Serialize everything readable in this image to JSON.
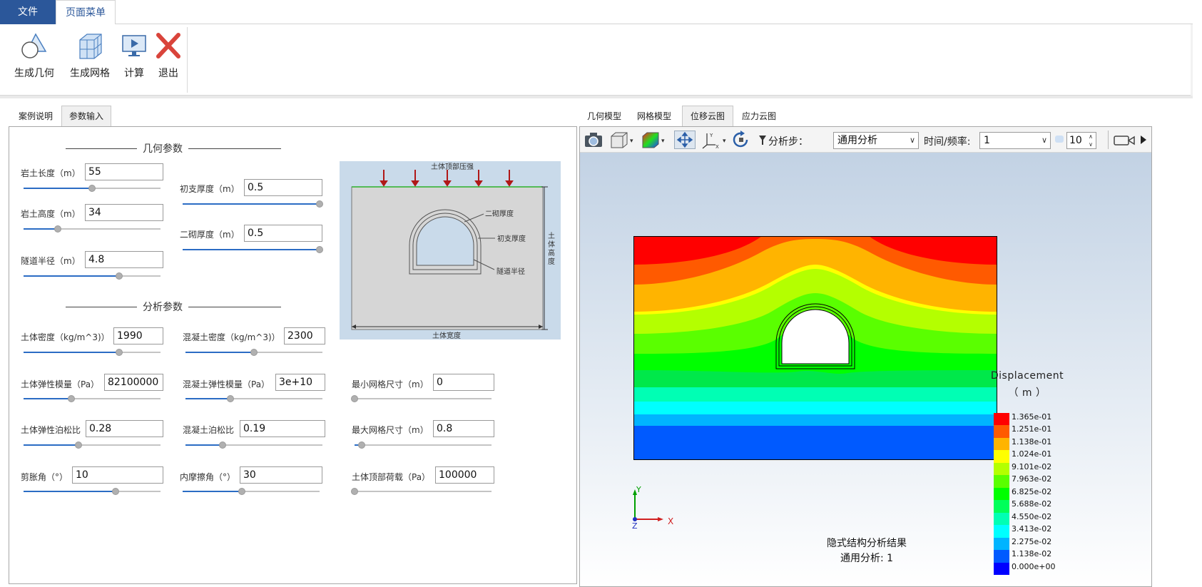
{
  "menu": {
    "file": "文件",
    "page": "页面菜单"
  },
  "ribbon": {
    "gen_geometry": "生成几何",
    "gen_mesh": "生成网格",
    "compute": "计算",
    "exit": "退出"
  },
  "left_tabs": [
    "案例说明",
    "参数输入"
  ],
  "right_tabs": [
    "几何模型",
    "网格模型",
    "位移云图",
    "应力云图"
  ],
  "geometry": {
    "title": "几何参数",
    "params": [
      {
        "label": "岩土长度（m）",
        "value": "55",
        "slider": 0.5
      },
      {
        "label": "岩土高度（m）",
        "value": "34",
        "slider": 0.25
      },
      {
        "label": "隧道半径（m）",
        "value": "4.8",
        "slider": 0.7
      },
      {
        "label": "初支厚度（m）",
        "value": "0.5",
        "slider": 1.0
      },
      {
        "label": "二砌厚度（m）",
        "value": "0.5",
        "slider": 1.0
      }
    ]
  },
  "analysis": {
    "title": "分析参数",
    "params": [
      {
        "label": "土体密度（kg/m^3)）",
        "value": "1990",
        "slider": 0.7
      },
      {
        "label": "混凝土密度（kg/m^3)）",
        "value": "2300",
        "slider": 0.5
      },
      {
        "label": "土体弹性模量（Pa）",
        "value": "82100000",
        "slider": 0.35
      },
      {
        "label": "混凝土弹性模量（Pa）",
        "value": "3e+10",
        "slider": 0.33
      },
      {
        "label": "最小网格尺寸（m）",
        "value": "0",
        "slider": 0.0
      },
      {
        "label": "土体弹性泊松比",
        "value": "0.28",
        "slider": 0.4
      },
      {
        "label": "混凝土泊松比",
        "value": "0.19",
        "slider": 0.27
      },
      {
        "label": "最大网格尺寸（m）",
        "value": "0.8",
        "slider": 0.05
      },
      {
        "label": "剪胀角（°）",
        "value": "10",
        "slider": 0.67
      },
      {
        "label": "内摩擦角（°）",
        "value": "30",
        "slider": 0.43
      },
      {
        "label": "土体顶部荷载（Pa）",
        "value": "100000",
        "slider": 0.0
      }
    ]
  },
  "diagram": {
    "top_pressure": "土体顶部压强",
    "secondary_lining": "二砌厚度",
    "primary_support": "初支厚度",
    "tunnel_radius": "隧道半径",
    "soil_height": "土体高度",
    "soil_width": "土体宽度"
  },
  "viewer": {
    "step_label": "分析步：",
    "step_value": "通用分析",
    "time_label": "时间/频率:",
    "time_value": "1",
    "frames_value": "10",
    "legend_title": "Displacement",
    "legend_unit": "（ m ）",
    "legend_values": [
      "1.365e-01",
      "1.251e-01",
      "1.138e-01",
      "1.024e-01",
      "9.101e-02",
      "7.963e-02",
      "6.825e-02",
      "5.688e-02",
      "4.550e-02",
      "3.413e-02",
      "2.275e-02",
      "1.138e-02",
      "0.000e+00"
    ],
    "legend_colors": [
      "#ff0000",
      "#ff5a00",
      "#ffb400",
      "#ffff00",
      "#b4ff00",
      "#5aff00",
      "#00ff00",
      "#00ff5a",
      "#00ffb4",
      "#00ffff",
      "#00b4ff",
      "#005aff",
      "#0000ff"
    ],
    "axis_x": "X",
    "axis_y": "Y",
    "axis_z": "Z",
    "caption_line1": "隐式结构分析结果",
    "caption_line2": "通用分析: 1"
  }
}
